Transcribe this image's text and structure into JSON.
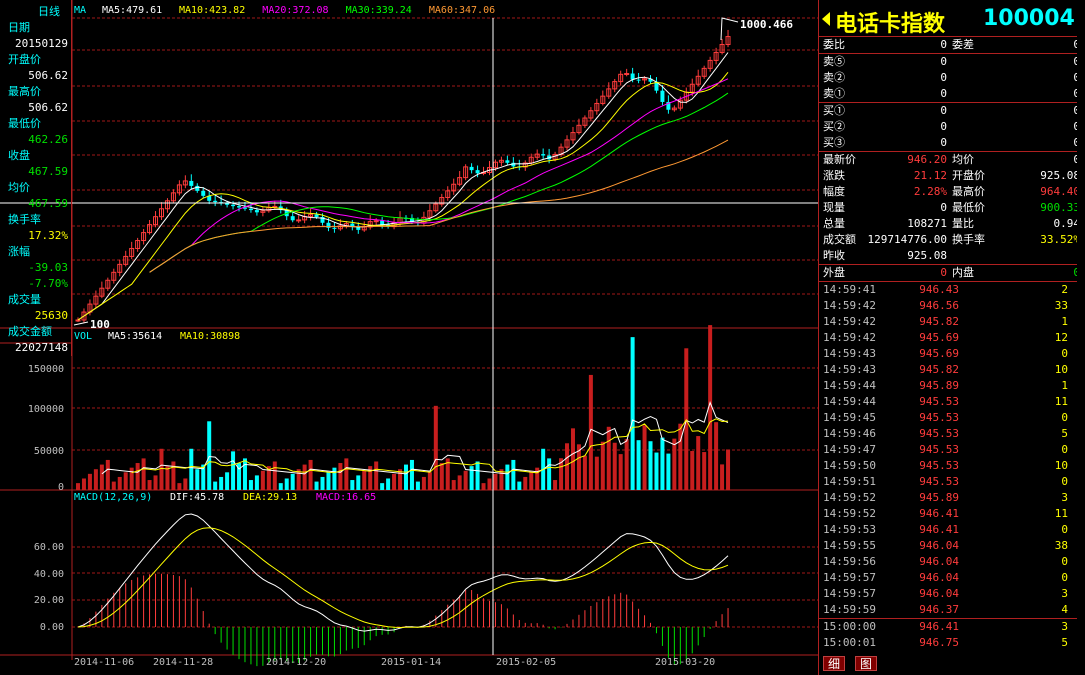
{
  "period": "日线",
  "left_info": [
    {
      "label": "日期",
      "value": "20150129",
      "vclass": "white"
    },
    {
      "label": "开盘价",
      "value": "506.62",
      "vclass": "white"
    },
    {
      "label": "最高价",
      "value": "506.62",
      "vclass": "white"
    },
    {
      "label": "最低价",
      "value": "462.26",
      "vclass": "green"
    },
    {
      "label": "收盘",
      "value": "467.59",
      "vclass": "green"
    },
    {
      "label": "均价",
      "value": "467.59",
      "vclass": "green"
    },
    {
      "label": "换手率",
      "value": "17.32%",
      "vclass": "yellow"
    },
    {
      "label": "涨幅",
      "value": "-39.03",
      "vclass": "green"
    },
    {
      "label": "",
      "value": "-7.70%",
      "vclass": "green"
    },
    {
      "label": "成交量",
      "value": "25630",
      "vclass": "yellow"
    },
    {
      "label": "成交金额",
      "value": "22027148",
      "vclass": "white"
    }
  ],
  "ma_legend": {
    "title": "MA",
    "items": [
      {
        "text": "MA5:479.61",
        "color": "#ffffff"
      },
      {
        "text": "MA10:423.82",
        "color": "#ffff00"
      },
      {
        "text": "MA20:372.08",
        "color": "#ff00ff"
      },
      {
        "text": "MA30:339.24",
        "color": "#00ff00"
      },
      {
        "text": "MA60:347.06",
        "color": "#ff9933"
      }
    ]
  },
  "vol_legend": {
    "title": "VOL",
    "items": [
      {
        "text": "MA5:35614",
        "color": "#ffffff"
      },
      {
        "text": "MA10:30898",
        "color": "#ffff00"
      }
    ]
  },
  "macd_legend": {
    "title": "MACD(12,26,9)",
    "items": [
      {
        "text": "DIF:45.78",
        "color": "#ffffff"
      },
      {
        "text": "DEA:29.13",
        "color": "#ffff00"
      },
      {
        "text": "MACD:16.65",
        "color": "#ff00ff"
      }
    ]
  },
  "price_annotations": {
    "high": "1000.466",
    "low": "100"
  },
  "vol_axis": [
    "150000",
    "100000",
    "50000",
    "0"
  ],
  "macd_axis": [
    "60.00",
    "40.00",
    "20.00",
    "0.00"
  ],
  "date_labels": [
    "2014-11-06",
    "2014-11-28",
    "2014-12-20",
    "2015-01-14",
    "2015-02-05",
    "2015-03-20"
  ],
  "title": {
    "name": "电话卡指数",
    "code": "100004"
  },
  "order_book": {
    "header": {
      "l1": "委比",
      "v1": "0",
      "l2": "委差",
      "v2": "0"
    },
    "sells": [
      {
        "label": "卖⑤",
        "price": "0",
        "vol": "0"
      },
      {
        "label": "卖②",
        "price": "0",
        "vol": "0"
      },
      {
        "label": "卖①",
        "price": "0",
        "vol": "0"
      }
    ],
    "buys": [
      {
        "label": "买①",
        "price": "0",
        "vol": "0"
      },
      {
        "label": "买②",
        "price": "0",
        "vol": "0"
      },
      {
        "label": "买③",
        "price": "0",
        "vol": "0"
      }
    ]
  },
  "quote": [
    {
      "l1": "最新价",
      "v1": "946.20",
      "c1": "red",
      "l2": "均价",
      "v2": "0",
      "c2": "white"
    },
    {
      "l1": "涨跌",
      "v1": "21.12",
      "c1": "red",
      "l2": "开盘价",
      "v2": "925.08",
      "c2": "white"
    },
    {
      "l1": "幅度",
      "v1": "2.28%",
      "c1": "red",
      "l2": "最高价",
      "v2": "964.40",
      "c2": "red"
    },
    {
      "l1": "现量",
      "v1": "0",
      "c1": "white",
      "l2": "最低价",
      "v2": "900.33",
      "c2": "green"
    },
    {
      "l1": "总量",
      "v1": "108271",
      "c1": "white",
      "l2": "量比",
      "v2": "0.94",
      "c2": "white"
    },
    {
      "l1": "成交额",
      "v1": "129714776.00",
      "c1": "white",
      "l2": "换手率",
      "v2": "33.52%",
      "c2": "yellow"
    },
    {
      "l1": "昨收",
      "v1": "925.08",
      "c1": "white",
      "l2": "",
      "v2": "",
      "c2": "white"
    }
  ],
  "outer_inner": {
    "l1": "外盘",
    "v1": "0",
    "l2": "内盘",
    "v2": "0"
  },
  "ticks": [
    {
      "time": "14:59:41",
      "price": "946.43",
      "vol": "2",
      "pc": "red"
    },
    {
      "time": "14:59:42",
      "price": "946.56",
      "vol": "33",
      "pc": "red"
    },
    {
      "time": "14:59:42",
      "price": "945.82",
      "vol": "1",
      "pc": "red"
    },
    {
      "time": "14:59:42",
      "price": "945.69",
      "vol": "12",
      "pc": "red"
    },
    {
      "time": "14:59:43",
      "price": "945.69",
      "vol": "0",
      "pc": "red"
    },
    {
      "time": "14:59:43",
      "price": "945.82",
      "vol": "10",
      "pc": "red"
    },
    {
      "time": "14:59:44",
      "price": "945.89",
      "vol": "1",
      "pc": "red"
    },
    {
      "time": "14:59:44",
      "price": "945.53",
      "vol": "11",
      "pc": "red"
    },
    {
      "time": "14:59:45",
      "price": "945.53",
      "vol": "0",
      "pc": "red"
    },
    {
      "time": "14:59:46",
      "price": "945.53",
      "vol": "5",
      "pc": "red"
    },
    {
      "time": "14:59:47",
      "price": "945.53",
      "vol": "0",
      "pc": "red"
    },
    {
      "time": "14:59:50",
      "price": "945.53",
      "vol": "10",
      "pc": "red"
    },
    {
      "time": "14:59:51",
      "price": "945.53",
      "vol": "0",
      "pc": "red"
    },
    {
      "time": "14:59:52",
      "price": "945.89",
      "vol": "3",
      "pc": "red"
    },
    {
      "time": "14:59:52",
      "price": "946.41",
      "vol": "11",
      "pc": "red"
    },
    {
      "time": "14:59:53",
      "price": "946.41",
      "vol": "0",
      "pc": "red"
    },
    {
      "time": "14:59:55",
      "price": "946.04",
      "vol": "38",
      "pc": "red"
    },
    {
      "time": "14:59:56",
      "price": "946.04",
      "vol": "0",
      "pc": "red"
    },
    {
      "time": "14:59:57",
      "price": "946.04",
      "vol": "0",
      "pc": "red"
    },
    {
      "time": "14:59:57",
      "price": "946.04",
      "vol": "3",
      "pc": "red"
    },
    {
      "time": "14:59:59",
      "price": "946.37",
      "vol": "4",
      "pc": "red"
    },
    {
      "time": "15:00:00",
      "price": "946.41",
      "vol": "3",
      "pc": "red"
    },
    {
      "time": "15:00:01",
      "price": "946.75",
      "vol": "5",
      "pc": "red"
    }
  ],
  "tabs": {
    "detail": "细",
    "chart": "图"
  }
}
